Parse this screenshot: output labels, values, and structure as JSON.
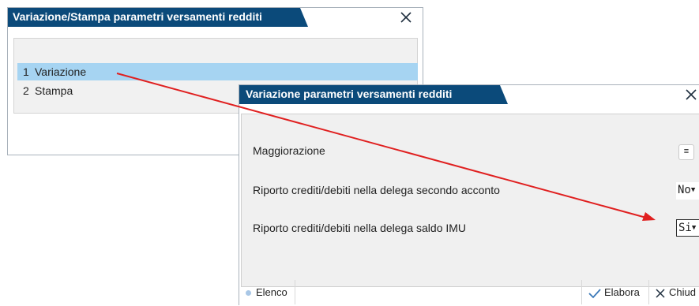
{
  "dialog_variazione_stampa": {
    "title": "Variazione/Stampa parametri versamenti redditi",
    "items": [
      {
        "num": "1",
        "label": "Variazione",
        "selected": true
      },
      {
        "num": "2",
        "label": "Stampa",
        "selected": false
      }
    ]
  },
  "dialog_variazione": {
    "title": "Variazione parametri versamenti redditi",
    "fields": {
      "maggiorazione": {
        "label": "Maggiorazione",
        "button": "≡"
      },
      "riporto_secondo_acconto": {
        "label": "Riporto crediti/debiti nella delega secondo acconto",
        "value": "No"
      },
      "riporto_saldo_imu": {
        "label": "Riporto crediti/debiti nella delega saldo IMU",
        "value": "Si"
      }
    },
    "footer": {
      "elenco": "Elenco",
      "elabora": "Elabora",
      "chiudi": "Chiud"
    }
  },
  "colors": {
    "title_bar": "#0b4a7a",
    "selection": "#a6d4f2",
    "annotation_arrow": "#e02020"
  }
}
